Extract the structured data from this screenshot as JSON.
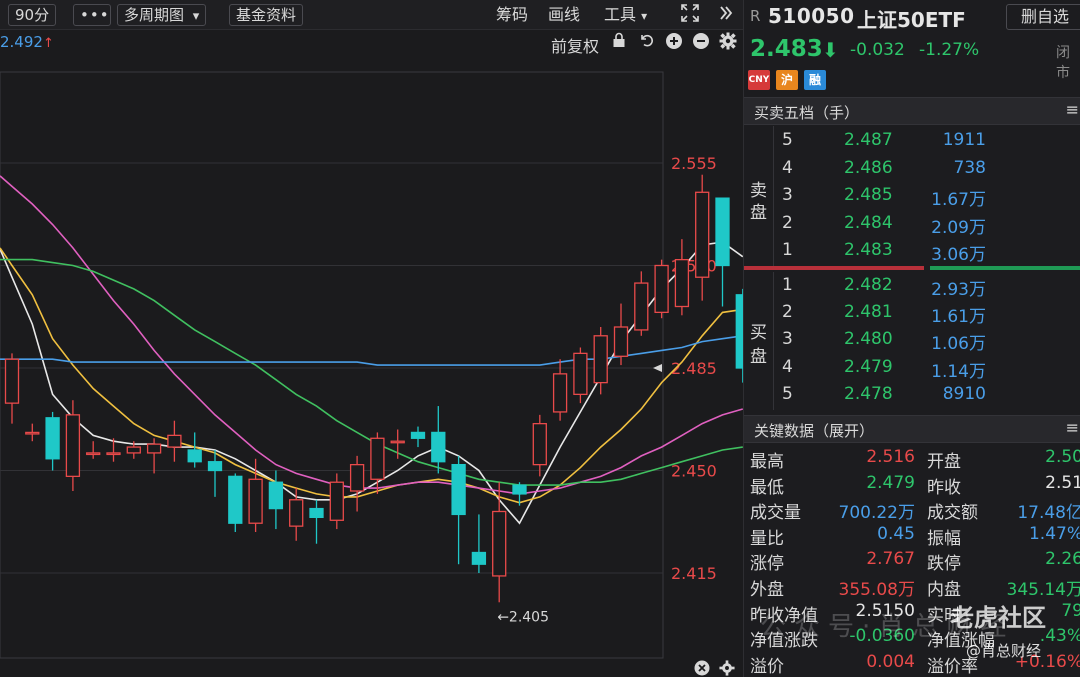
{
  "toolbar": {
    "period": "90分",
    "more": "•••",
    "multi_period": "多周期图",
    "multi_period_caret": "▾",
    "fund_info": "基金资料",
    "chips": "筹码",
    "draw": "画线",
    "tools": "工具",
    "tools_caret": "▾",
    "expand_icon": "expand-icon",
    "collapse_icon": "double-chevron-right-icon"
  },
  "chart_header": {
    "ma_value": "2.492",
    "ma_arrow": "↑",
    "adjust": "前复权",
    "icons": [
      "lock-icon",
      "undo-icon",
      "zoom-in-icon",
      "zoom-out-icon",
      "gear-icon"
    ]
  },
  "chart_data": {
    "type": "candlestick",
    "price_axis_labels": [
      "2.555",
      "2.520",
      "2.485",
      "2.450",
      "2.415"
    ],
    "ylim": [
      2.395,
      2.585
    ],
    "low_annotation": "←2.405",
    "candles": [
      {
        "o": 2.473,
        "c": 2.488,
        "h": 2.49,
        "l": 2.466
      },
      {
        "o": 2.463,
        "c": 2.463,
        "h": 2.466,
        "l": 2.46
      },
      {
        "o": 2.468,
        "c": 2.454,
        "h": 2.47,
        "l": 2.45
      },
      {
        "o": 2.448,
        "c": 2.469,
        "h": 2.474,
        "l": 2.443
      },
      {
        "o": 2.456,
        "c": 2.456,
        "h": 2.46,
        "l": 2.454
      },
      {
        "o": 2.456,
        "c": 2.456,
        "h": 2.461,
        "l": 2.453
      },
      {
        "o": 2.456,
        "c": 2.458,
        "h": 2.46,
        "l": 2.454
      },
      {
        "o": 2.456,
        "c": 2.459,
        "h": 2.461,
        "l": 2.449
      },
      {
        "o": 2.458,
        "c": 2.462,
        "h": 2.467,
        "l": 2.453
      },
      {
        "o": 2.457,
        "c": 2.453,
        "h": 2.463,
        "l": 2.451
      },
      {
        "o": 2.453,
        "c": 2.45,
        "h": 2.457,
        "l": 2.441
      },
      {
        "o": 2.448,
        "c": 2.432,
        "h": 2.449,
        "l": 2.429
      },
      {
        "o": 2.432,
        "c": 2.447,
        "h": 2.454,
        "l": 2.429
      },
      {
        "o": 2.446,
        "c": 2.437,
        "h": 2.45,
        "l": 2.43
      },
      {
        "o": 2.431,
        "c": 2.44,
        "h": 2.444,
        "l": 2.426
      },
      {
        "o": 2.437,
        "c": 2.434,
        "h": 2.44,
        "l": 2.425
      },
      {
        "o": 2.433,
        "c": 2.446,
        "h": 2.449,
        "l": 2.43
      },
      {
        "o": 2.443,
        "c": 2.452,
        "h": 2.455,
        "l": 2.436
      },
      {
        "o": 2.447,
        "c": 2.461,
        "h": 2.463,
        "l": 2.442
      },
      {
        "o": 2.46,
        "c": 2.46,
        "h": 2.464,
        "l": 2.454
      },
      {
        "o": 2.463,
        "c": 2.461,
        "h": 2.465,
        "l": 2.458
      },
      {
        "o": 2.463,
        "c": 2.453,
        "h": 2.472,
        "l": 2.449
      },
      {
        "o": 2.452,
        "c": 2.435,
        "h": 2.455,
        "l": 2.418
      },
      {
        "o": 2.422,
        "c": 2.418,
        "h": 2.435,
        "l": 2.415
      },
      {
        "o": 2.414,
        "c": 2.436,
        "h": 2.446,
        "l": 2.405
      },
      {
        "o": 2.445,
        "c": 2.442,
        "h": 2.446,
        "l": 2.438
      },
      {
        "o": 2.452,
        "c": 2.466,
        "h": 2.469,
        "l": 2.448
      },
      {
        "o": 2.47,
        "c": 2.483,
        "h": 2.488,
        "l": 2.467
      },
      {
        "o": 2.476,
        "c": 2.49,
        "h": 2.492,
        "l": 2.473
      },
      {
        "o": 2.48,
        "c": 2.496,
        "h": 2.499,
        "l": 2.476
      },
      {
        "o": 2.489,
        "c": 2.499,
        "h": 2.507,
        "l": 2.486
      },
      {
        "o": 2.498,
        "c": 2.514,
        "h": 2.518,
        "l": 2.496
      },
      {
        "o": 2.504,
        "c": 2.52,
        "h": 2.522,
        "l": 2.502
      },
      {
        "o": 2.506,
        "c": 2.522,
        "h": 2.529,
        "l": 2.503
      },
      {
        "o": 2.516,
        "c": 2.545,
        "h": 2.551,
        "l": 2.508
      },
      {
        "o": 2.543,
        "c": 2.52,
        "h": 2.543,
        "l": 2.506
      },
      {
        "o": 2.51,
        "c": 2.485,
        "h": 2.512,
        "l": 2.48
      }
    ],
    "ma_lines": [
      {
        "name": "ma5",
        "color": "#e8e8e8",
        "values": [
          2.516,
          2.5,
          2.476,
          2.468,
          2.462,
          2.46,
          2.459,
          2.459,
          2.458,
          2.458,
          2.457,
          2.454,
          2.45,
          2.446,
          2.441,
          2.44,
          2.44,
          2.442,
          2.446,
          2.45,
          2.455,
          2.458,
          2.455,
          2.45,
          2.44,
          2.432,
          2.445,
          2.458,
          2.47,
          2.482,
          2.494,
          2.503,
          2.512,
          2.519,
          2.527,
          2.528,
          2.523
        ]
      },
      {
        "name": "ma10",
        "color": "#f0c040",
        "values": [
          2.52,
          2.51,
          2.495,
          2.486,
          2.478,
          2.472,
          2.466,
          2.462,
          2.46,
          2.458,
          2.456,
          2.452,
          2.449,
          2.446,
          2.444,
          2.442,
          2.441,
          2.441,
          2.443,
          2.445,
          2.446,
          2.447,
          2.446,
          2.444,
          2.441,
          2.439,
          2.441,
          2.445,
          2.451,
          2.458,
          2.464,
          2.471,
          2.48,
          2.487,
          2.496,
          2.504,
          2.505
        ]
      },
      {
        "name": "ma20",
        "color": "#e060c0",
        "values": [
          2.547,
          2.541,
          2.534,
          2.526,
          2.517,
          2.508,
          2.5,
          2.491,
          2.483,
          2.476,
          2.469,
          2.463,
          2.457,
          2.452,
          2.449,
          2.447,
          2.445,
          2.444,
          2.444,
          2.445,
          2.446,
          2.446,
          2.445,
          2.444,
          2.443,
          2.442,
          2.443,
          2.444,
          2.446,
          2.448,
          2.451,
          2.455,
          2.458,
          2.462,
          2.466,
          2.469,
          2.471
        ]
      },
      {
        "name": "ma30",
        "color": "#40c060",
        "values": [
          2.522,
          2.522,
          2.521,
          2.52,
          2.518,
          2.515,
          2.512,
          2.508,
          2.503,
          2.498,
          2.494,
          2.49,
          2.486,
          2.481,
          2.476,
          2.472,
          2.467,
          2.463,
          2.459,
          2.456,
          2.453,
          2.451,
          2.449,
          2.447,
          2.446,
          2.445,
          2.445,
          2.445,
          2.446,
          2.446,
          2.447,
          2.449,
          2.451,
          2.453,
          2.455,
          2.457,
          2.458
        ]
      },
      {
        "name": "ma60",
        "color": "#4a9ee8",
        "values": [
          2.488,
          2.488,
          2.488,
          2.487,
          2.487,
          2.487,
          2.487,
          2.487,
          2.487,
          2.487,
          2.487,
          2.487,
          2.487,
          2.487,
          2.487,
          2.487,
          2.487,
          2.487,
          2.486,
          2.486,
          2.486,
          2.486,
          2.486,
          2.486,
          2.486,
          2.486,
          2.486,
          2.487,
          2.488,
          2.488,
          2.489,
          2.49,
          2.491,
          2.492,
          2.494,
          2.495,
          2.496
        ]
      }
    ],
    "current_price_marker": 2.485,
    "grid": true
  },
  "chart_bottom": {
    "icons": [
      "close-icon",
      "gear-icon"
    ]
  },
  "quote": {
    "mark": "R",
    "code": "510050",
    "name": "上证50ETF",
    "fav": "删自选",
    "price": "2.483",
    "arrow": "⬇",
    "change": "-0.032",
    "pct": "-1.27%",
    "status": "闭市",
    "badges": [
      {
        "text": "CNY",
        "color": "#d63a3a"
      },
      {
        "text": "沪",
        "color": "#e8861e"
      },
      {
        "text": "融",
        "color": "#2a8ad8"
      }
    ]
  },
  "orderbook": {
    "title": "买卖五档（手）",
    "menu": "≡",
    "sell_label": [
      "卖",
      "盘"
    ],
    "buy_label": [
      "买",
      "盘"
    ],
    "asks": [
      {
        "lv": "5",
        "px": "2.487",
        "vol": "1911"
      },
      {
        "lv": "4",
        "px": "2.486",
        "vol": "738"
      },
      {
        "lv": "3",
        "px": "2.485",
        "vol": "1.67万"
      },
      {
        "lv": "2",
        "px": "2.484",
        "vol": "2.09万"
      },
      {
        "lv": "1",
        "px": "2.483",
        "vol": "3.06万"
      }
    ],
    "bids": [
      {
        "lv": "1",
        "px": "2.482",
        "vol": "2.93万"
      },
      {
        "lv": "2",
        "px": "2.481",
        "vol": "1.61万"
      },
      {
        "lv": "3",
        "px": "2.480",
        "vol": "1.06万"
      },
      {
        "lv": "4",
        "px": "2.479",
        "vol": "1.14万"
      },
      {
        "lv": "5",
        "px": "2.478",
        "vol": "8910"
      }
    ]
  },
  "keydata": {
    "title": "关键数据（展开）",
    "menu": "≡",
    "rows": [
      {
        "l1": "最高",
        "v1": "2.516",
        "c1": "#e84a4a",
        "l2": "开盘",
        "v2": "2.50",
        "c2": "#2ec56b"
      },
      {
        "l1": "最低",
        "v1": "2.479",
        "c1": "#2ec56b",
        "l2": "昨收",
        "v2": "2.51",
        "c2": "#e6e6e6"
      },
      {
        "l1": "成交量",
        "v1": "700.22万",
        "c1": "#4a9ee8",
        "l2": "成交额",
        "v2": "17.48亿",
        "c2": "#4a9ee8"
      },
      {
        "l1": "量比",
        "v1": "0.45",
        "c1": "#4a9ee8",
        "l2": "振幅",
        "v2": "1.47%",
        "c2": "#4a9ee8"
      },
      {
        "l1": "涨停",
        "v1": "2.767",
        "c1": "#e84a4a",
        "l2": "跌停",
        "v2": "2.26",
        "c2": "#2ec56b"
      },
      {
        "l1": "外盘",
        "v1": "355.08万",
        "c1": "#e84a4a",
        "l2": "内盘",
        "v2": "345.14万",
        "c2": "#2ec56b"
      },
      {
        "l1": "昨收净值",
        "v1": "2.5150",
        "c1": "#e6e6e6",
        "l2": "实时",
        "v2": "79",
        "c2": "#2ec56b"
      },
      {
        "l1": "净值涨跌",
        "v1": "-0.0360",
        "c1": "#2ec56b",
        "l2": "净值涨幅",
        "v2": ".43%",
        "c2": "#2ec56b"
      },
      {
        "l1": "溢价",
        "v1": "0.004",
        "c1": "#e84a4a",
        "l2": "溢价率",
        "v2": "+0.16%",
        "c2": "#e84a4a"
      }
    ]
  },
  "watermark": {
    "main": "老虎社区",
    "sub": "@肖总财经",
    "faint": "公众号·肖总财经"
  }
}
